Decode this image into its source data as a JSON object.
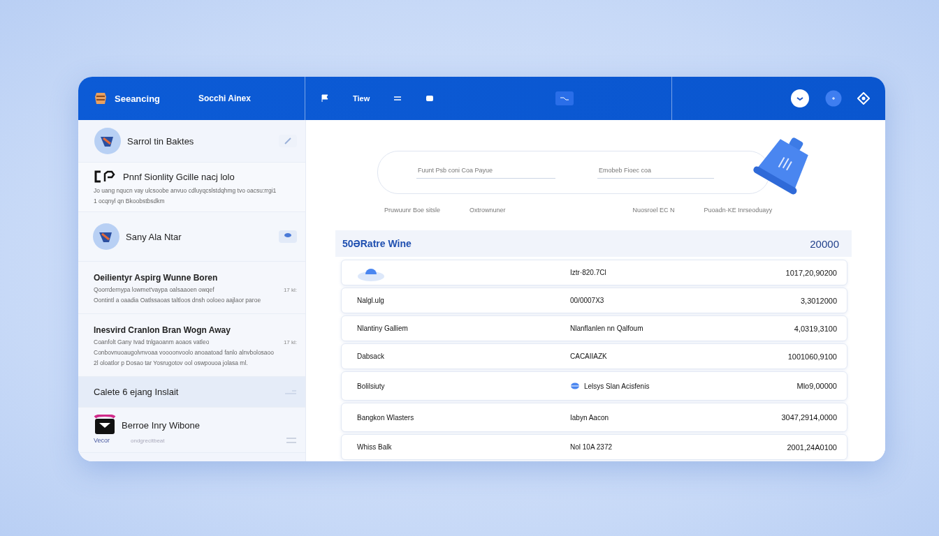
{
  "header": {
    "brand": "Seeancing",
    "search": "Socchi Ainex",
    "nav_label": "Tiew"
  },
  "sidebar": {
    "items": [
      {
        "kind": "profile",
        "title": "Sarrol tin Baktes"
      },
      {
        "kind": "note",
        "title": "Pnnf Sionlity Gcille nacj lolo",
        "lines": [
          "Jo uang nqucn vay ulcsoobe anvuo cdluyqcslstdqhmg tvo oacsu:rrgi1",
          "1 ocqnyl qn Bkoobstbsdkm"
        ]
      },
      {
        "kind": "contact",
        "title": "Sany Ala Ntar"
      },
      {
        "kind": "message",
        "title": "Oeilientyr Aspirg Wunne Boren",
        "time": "17 kl:",
        "lines": [
          "Qoorrdernypa lowmet'vaypa oalsaaoen owqef",
          "Oontintl a oaadia Oatlssaoas taltloos dnsh ooloeo aajlaor paroe"
        ]
      },
      {
        "kind": "message",
        "title": "Inesvird  Cranlon Bran  Wogn Away",
        "time": "17 kl:",
        "lines": [
          "Coanfolt Gany Ivad tnlgaoanm aoaos vatleo",
          "Conbovnuoaugolvnvoaa voooonvoolo anoaatoad fanlo alnvbolosaoo",
          "2l oloatlor p Dosao tar Yosrugotov ool oswpouoa jolasa ml."
        ]
      },
      {
        "kind": "section",
        "title": "Calete  6 ejang Inslait",
        "selected": true
      },
      {
        "kind": "person",
        "title": "Berroe Inry Wibone",
        "tag": "Vecor",
        "subtitle": "ondgrecitbeat"
      }
    ]
  },
  "form": {
    "fields": [
      {
        "label": "Fuunt Psb coni Coa Payue"
      },
      {
        "label": "Emobeb Fioec coa"
      }
    ],
    "captions": [
      "Pruwuunr Boe sitsle",
      "Oxtrownuner",
      "Nuosroel EC N",
      "Puoadn·KE Inrseoduayy"
    ]
  },
  "summary": {
    "title": "50ƏRatre Wine",
    "total": "20000"
  },
  "table": {
    "rows": [
      {
        "kind": "media",
        "cells": [
          "",
          "Iztr·820.7Cl",
          "1017,20,90200"
        ]
      },
      {
        "cells": [
          "Nalgl.ulg",
          "00/0007X3",
          "3,3012000"
        ]
      },
      {
        "cells": [
          "Nlantiny Galliem",
          "Nlanflanlen nn Qalfoum",
          "4,0319,3100"
        ]
      },
      {
        "cells": [
          "Dabsack",
          "CACAIIAZK",
          "1001060,9100"
        ]
      },
      {
        "kind": "tagged",
        "cells": [
          "Bolilsiuty",
          "Lelsys Slan Acisfenis",
          "Mlo9,00000"
        ]
      },
      {
        "cells": [
          "Bangkon Wlasters",
          "Iabyn Aacon",
          "3047,2914,0000"
        ]
      },
      {
        "cells": [
          "Whiss Balk",
          "Nol 10A 2372",
          "2001,24A0100"
        ]
      }
    ]
  }
}
